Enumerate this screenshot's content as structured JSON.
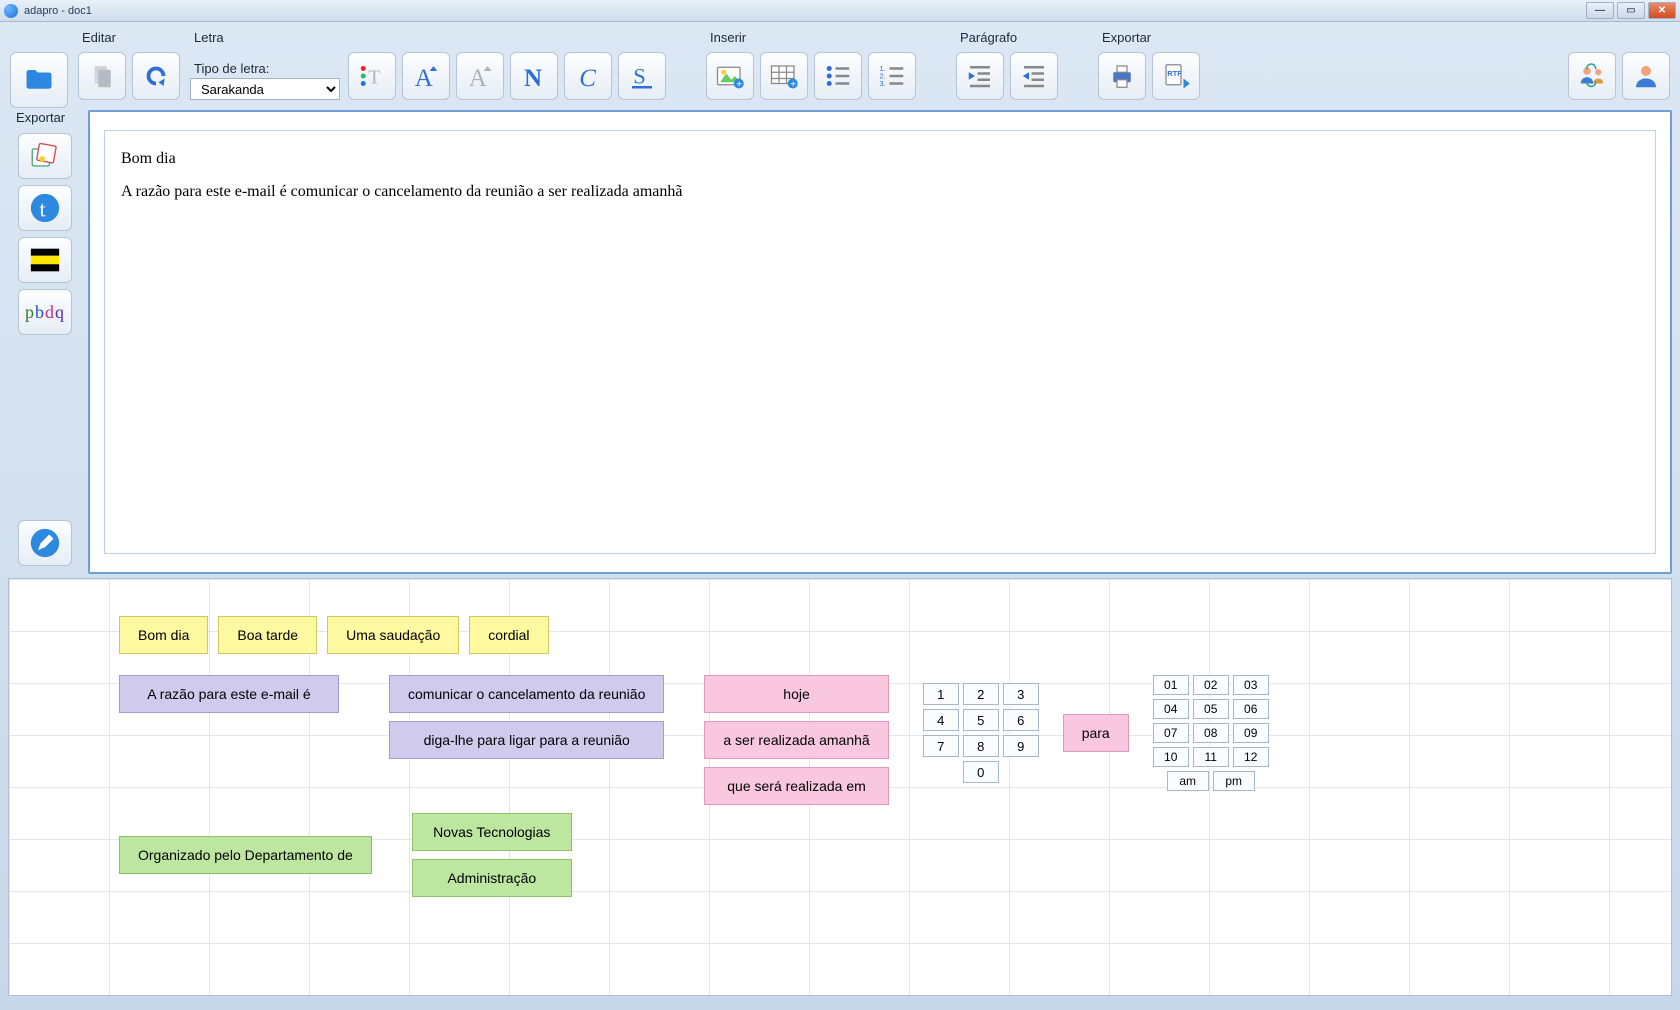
{
  "window": {
    "title": "adapro - doc1"
  },
  "ribbon": {
    "editar": {
      "label": "Editar"
    },
    "letra": {
      "label": "Letra",
      "tipo_label": "Tipo de letra:",
      "font": "Sarakanda"
    },
    "inserir": {
      "label": "Inserir"
    },
    "paragrafo": {
      "label": "Parágrafo"
    },
    "exportar": {
      "label": "Exportar"
    }
  },
  "sidebar": {
    "title": "Exportar",
    "pbdq": {
      "p": "p",
      "b": "b",
      "d": "d",
      "q": "q"
    }
  },
  "editor": {
    "line1": "Bom dia",
    "line2": "A razão para este e-mail é comunicar o cancelamento da reunião a ser realizada amanhã"
  },
  "suggestions": {
    "yellow": [
      "Bom dia",
      "Boa tarde",
      "Uma saudação",
      "cordial"
    ],
    "purple_left": "A razão para este e-mail é",
    "purple_mid": [
      "comunicar o cancelamento da reunião",
      "diga-lhe para ligar para a reunião"
    ],
    "pink_right": [
      "hoje",
      "a ser realizada amanhã",
      "que será realizada em"
    ],
    "pink_para": "para",
    "green_left": "Organizado pelo Departamento de",
    "green_mid": [
      "Novas Tecnologias",
      "Administração"
    ],
    "numpad": [
      "1",
      "2",
      "3",
      "4",
      "5",
      "6",
      "7",
      "8",
      "9",
      "0"
    ],
    "timepad": [
      "01",
      "02",
      "03",
      "04",
      "05",
      "06",
      "07",
      "08",
      "09",
      "10",
      "11",
      "12"
    ],
    "ampm": [
      "am",
      "pm"
    ]
  }
}
